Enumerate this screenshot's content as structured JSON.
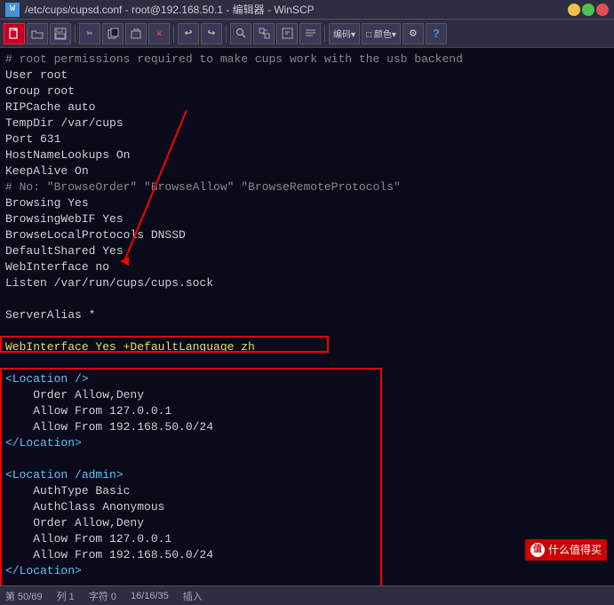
{
  "window": {
    "title": "/etc/cups/cupsd.conf - root@192.168.50.1 - 编辑器 - WinSCP",
    "icon": "W"
  },
  "toolbar": {
    "buttons": [
      {
        "id": "new",
        "label": "□",
        "active": true
      },
      {
        "id": "open",
        "label": "📂"
      },
      {
        "id": "save",
        "label": "💾"
      },
      {
        "id": "cut",
        "label": "✂"
      },
      {
        "id": "copy",
        "label": "⎘"
      },
      {
        "id": "paste",
        "label": "📋"
      },
      {
        "id": "delete",
        "label": "✕"
      },
      {
        "id": "undo",
        "label": "↩"
      },
      {
        "id": "redo",
        "label": "↪"
      },
      {
        "id": "find",
        "label": "⊞"
      },
      {
        "id": "replace",
        "label": "⊟"
      },
      {
        "id": "goto",
        "label": "⊠"
      },
      {
        "id": "wordwrap",
        "label": "≡"
      },
      {
        "id": "encoding",
        "label": "编码▾"
      },
      {
        "id": "color",
        "label": "□颜色▾"
      },
      {
        "id": "settings",
        "label": "⚙"
      },
      {
        "id": "help",
        "label": "?"
      }
    ]
  },
  "editor": {
    "content": [
      "# root permissions required to make cups work with the usb backend",
      "User root",
      "Group root",
      "RIPCache auto",
      "TempDir /var/cups",
      "Port 631",
      "HostNameLookups On",
      "KeepAlive On",
      "# No: \"BrowseOrder\" \"BrowseAllow\" \"BrowseRemoteProtocols\"",
      "Browsing Yes",
      "BrowsingWebIF Yes",
      "BrowseLocalProtocols DNSSD",
      "DefaultShared Yes",
      "WebInterface no",
      "Listen /var/run/cups/cups.sock",
      "",
      "ServerAlias *",
      "",
      "WebInterface Yes +DefaultLanguage zh",
      "",
      "<Location />",
      "    Order Allow,Deny",
      "    Allow From 127.0.0.1",
      "    Allow From 192.168.50.0/24",
      "</Location>",
      "",
      "<Location /admin>",
      "    AuthType Basic",
      "    AuthClass Anonymous",
      "    Order Allow,Deny",
      "    Allow From 127.0.0.1",
      "    Allow From 192.168.50.0/24",
      "</Location>"
    ]
  },
  "status_bar": {
    "line": "第 50/69",
    "col": "列 1",
    "chars": "字符 0",
    "encoding": "16/16/35",
    "mode": "插入"
  },
  "watermark": {
    "text": "什么值得买",
    "logo": "值"
  }
}
